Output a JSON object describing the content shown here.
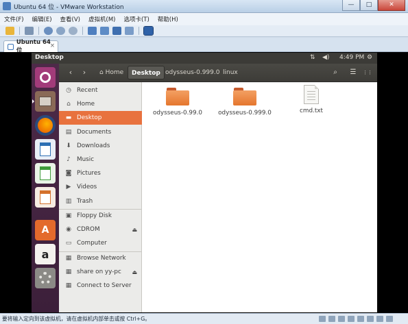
{
  "window": {
    "title": "Ubuntu 64 位 - VMware Workstation",
    "minimize": "—",
    "maximize": "□",
    "close": "✕"
  },
  "menu": [
    "文件(F)",
    "编辑(E)",
    "查看(V)",
    "虚拟机(M)",
    "选项卡(T)",
    "帮助(H)"
  ],
  "tab": {
    "label": "Ubuntu 64 位",
    "close": "×"
  },
  "panel": {
    "app_name": "Desktop",
    "time": "4:49 PM",
    "network_icon": "⇅",
    "volume_icon": "◀)",
    "gear_icon": "⚙"
  },
  "nautilus": {
    "back": "‹",
    "forward": "›",
    "breadcrumbs": [
      {
        "label": "Home",
        "icon": "home-icon"
      },
      {
        "label": "Desktop"
      },
      {
        "label": "odysseus-0.999.0"
      },
      {
        "label": "linux"
      }
    ],
    "search_icon": "⌕",
    "list_icon": "☰",
    "grid_icon": "⋮⋮"
  },
  "sidebar": {
    "items": [
      {
        "label": "Recent",
        "glyph": "◷"
      },
      {
        "label": "Home",
        "glyph": "⌂"
      },
      {
        "label": "Desktop",
        "glyph": "▬",
        "selected": true
      },
      {
        "label": "Documents",
        "glyph": "▤"
      },
      {
        "label": "Downloads",
        "glyph": "⬇"
      },
      {
        "label": "Music",
        "glyph": "♪"
      },
      {
        "label": "Pictures",
        "glyph": "◙"
      },
      {
        "label": "Videos",
        "glyph": "▶"
      },
      {
        "label": "Trash",
        "glyph": "▥"
      },
      {
        "label": "Floppy Disk",
        "glyph": "▣"
      },
      {
        "label": "CDROM",
        "glyph": "◉",
        "eject": "⏏"
      },
      {
        "label": "Computer",
        "glyph": "▭"
      },
      {
        "label": "Browse Network",
        "glyph": "▦"
      },
      {
        "label": "share on yy-pc",
        "glyph": "▦",
        "eject": "⏏"
      },
      {
        "label": "Connect to Server",
        "glyph": "▦"
      }
    ]
  },
  "files": [
    {
      "name": "odysseus-0.99.0",
      "type": "folder"
    },
    {
      "name": "odysseus-0.999.0",
      "type": "folder"
    },
    {
      "name": "cmd.txt",
      "type": "text"
    }
  ],
  "launcher": [
    "dash",
    "files",
    "firefox",
    "writer",
    "calc",
    "impress",
    "software-center",
    "amazon",
    "system-settings"
  ],
  "colors": {
    "accent": "#e8723e",
    "panel": "#3c3b37",
    "launcher": "#4d2a48"
  },
  "status": {
    "text": "要将输入定向到该虚拟机，请在虚拟机内部单击或按 Ctrl+G。"
  }
}
